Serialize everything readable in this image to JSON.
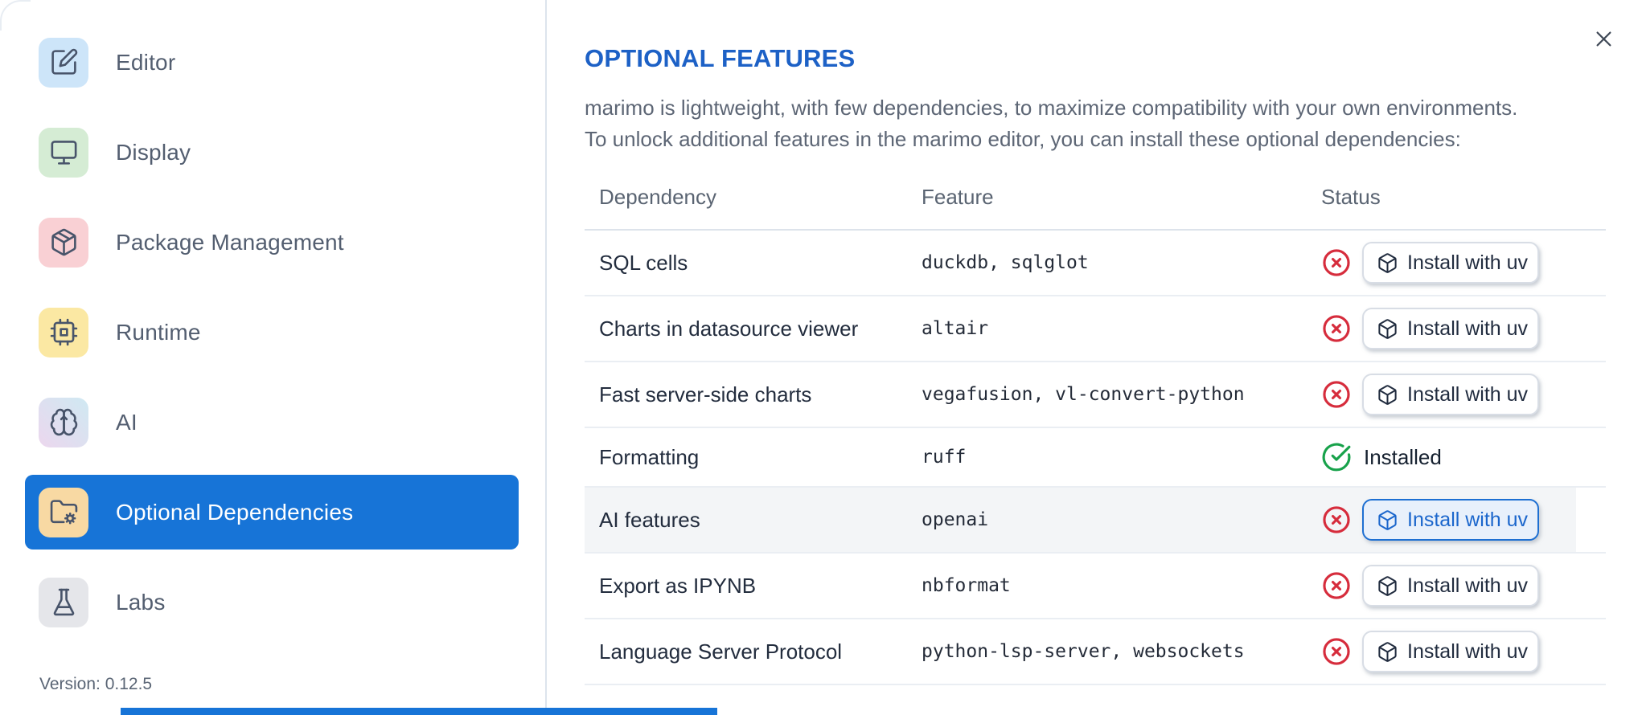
{
  "sidebar": {
    "items": [
      {
        "label": "Editor",
        "icon": "edit-square-icon",
        "selected": false
      },
      {
        "label": "Display",
        "icon": "monitor-icon",
        "selected": false
      },
      {
        "label": "Package Management",
        "icon": "package-icon",
        "selected": false
      },
      {
        "label": "Runtime",
        "icon": "cpu-icon",
        "selected": false
      },
      {
        "label": "AI",
        "icon": "brain-icon",
        "selected": false
      },
      {
        "label": "Optional Dependencies",
        "icon": "folder-cog-icon",
        "selected": true
      },
      {
        "label": "Labs",
        "icon": "flask-icon",
        "selected": false
      }
    ],
    "version_label": "Version: 0.12.5"
  },
  "dialog": {
    "title": "OPTIONAL FEATURES",
    "description_line1": "marimo is lightweight, with few dependencies, to maximize compatibility with your own environments.",
    "description_line2": "To unlock additional features in the marimo editor, you can install these optional dependencies:"
  },
  "table": {
    "columns": {
      "dependency": "Dependency",
      "feature": "Feature",
      "status": "Status"
    },
    "install_button_label": "Install with uv",
    "rows": [
      {
        "dependency": "SQL cells",
        "feature": "duckdb, sqlglot",
        "installed": false
      },
      {
        "dependency": "Charts in datasource viewer",
        "feature": "altair",
        "installed": false
      },
      {
        "dependency": "Fast server-side charts",
        "feature": "vegafusion, vl-convert-python",
        "installed": false
      },
      {
        "dependency": "Formatting",
        "feature": "ruff",
        "installed": true,
        "status_label": "Installed"
      },
      {
        "dependency": "AI features",
        "feature": "openai",
        "installed": false,
        "focused": true,
        "highlighted": true
      },
      {
        "dependency": "Export as IPYNB",
        "feature": "nbformat",
        "installed": false
      },
      {
        "dependency": "Language Server Protocol",
        "feature": "python-lsp-server, websockets",
        "installed": false
      }
    ]
  },
  "colors": {
    "accent": "#1774d7",
    "title_blue": "#1d61c6",
    "danger": "#d62c3c",
    "success": "#18a24b",
    "row_highlight": "#f3f5f7",
    "tint_editor": "#cde5f9",
    "tint_display": "#d5ecd4",
    "tint_package": "#f9d0d4",
    "tint_runtime": "#fbe8a3",
    "tint_ai_from": "#ecd7ee",
    "tint_ai_to": "#cfe9f2",
    "tint_optional": "#f8d9a3",
    "tint_labs": "#e5e6ea"
  }
}
